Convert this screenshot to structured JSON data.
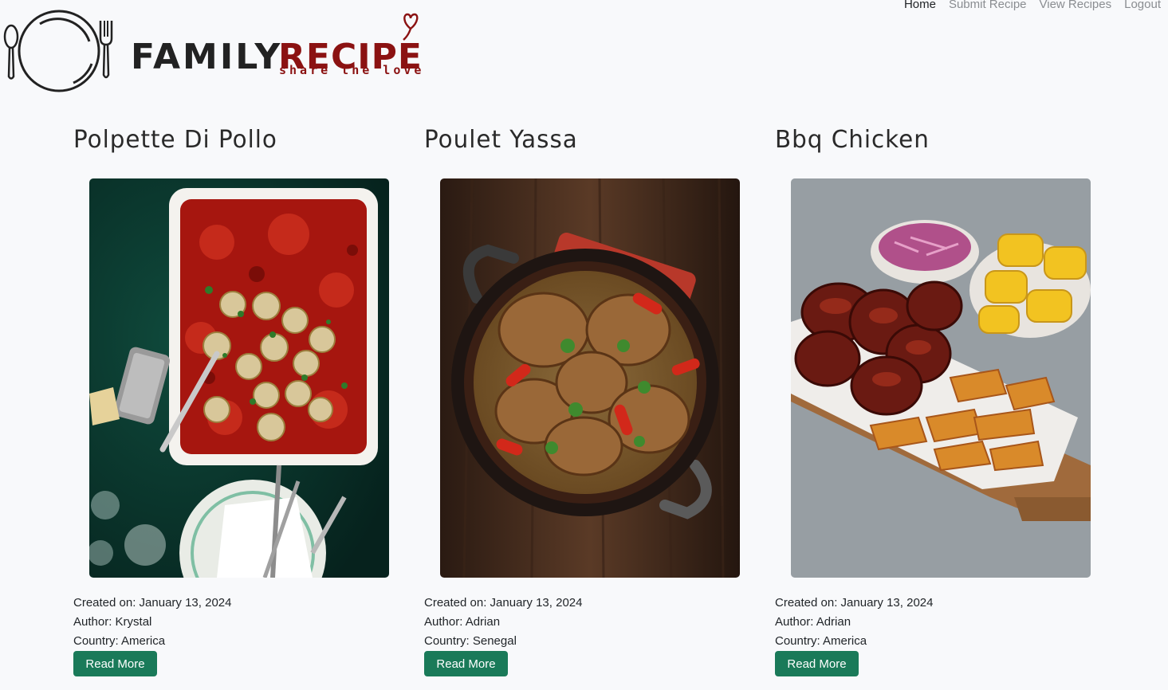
{
  "nav": {
    "items": [
      {
        "label": "Home",
        "active": true
      },
      {
        "label": "Submit Recipe",
        "active": false
      },
      {
        "label": "View Recipes",
        "active": false
      },
      {
        "label": "Logout",
        "active": false
      }
    ]
  },
  "logo": {
    "word1": "FAMILY",
    "word2": "RECIPE",
    "tagline": "share the love",
    "accent_color": "#8b1212"
  },
  "recipes": [
    {
      "title": "Polpette Di Pollo",
      "created_label": "Created on: January 13, 2024",
      "author_label": "Author: Krystal",
      "country_label": "Country: America",
      "button_label": "Read More"
    },
    {
      "title": "Poulet Yassa",
      "created_label": "Created on: January 13, 2024",
      "author_label": "Author: Adrian",
      "country_label": "Country: Senegal",
      "button_label": "Read More"
    },
    {
      "title": "Bbq Chicken",
      "created_label": "Created on: January 13, 2024",
      "author_label": "Author: Adrian",
      "country_label": "Country: America",
      "button_label": "Read More"
    }
  ],
  "colors": {
    "button": "#1a7a59",
    "background": "#f8f9fb"
  }
}
